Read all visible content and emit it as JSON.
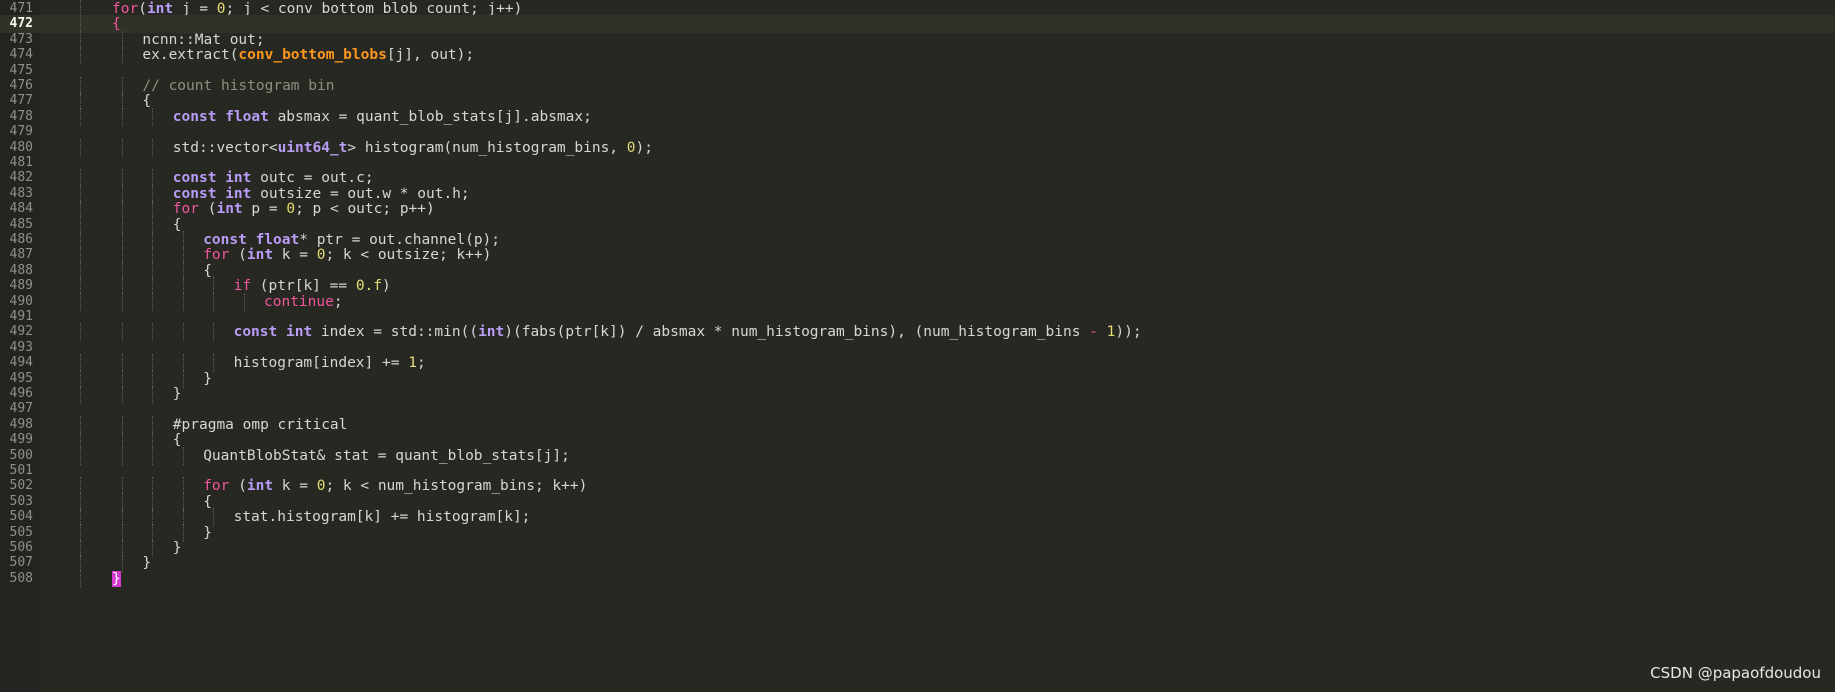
{
  "editor": {
    "watermark": "CSDN @papaofdoudou",
    "current_line": "472",
    "colors": {
      "background": "#272822",
      "keyword_control": "#f0579c",
      "keyword_type": "#b99cf5",
      "number": "#e6db74",
      "highlight_function": "#fd971f",
      "comment": "#8e8d80"
    },
    "lines": [
      {
        "num": "471",
        "indent": 1,
        "tokens": [
          [
            "kw-ctrl",
            "for"
          ],
          [
            "",
            "("
          ],
          [
            "kw-type",
            "int"
          ],
          [
            "",
            " j = "
          ],
          [
            "num",
            "0"
          ],
          [
            "",
            "; j < conv_bottom_blob_count; j++)"
          ]
        ]
      },
      {
        "num": "472",
        "indent": 1,
        "tokens": [
          [
            "kw-ctrl",
            "{"
          ]
        ]
      },
      {
        "num": "473",
        "indent": 2,
        "tokens": [
          [
            "",
            "ncnn::Mat out;"
          ]
        ]
      },
      {
        "num": "474",
        "indent": 2,
        "tokens": [
          [
            "",
            "ex.extract("
          ],
          [
            "fn-hl",
            "conv_bottom_blobs"
          ],
          [
            "",
            "[j], out);"
          ]
        ]
      },
      {
        "num": "475",
        "indent": 0,
        "tokens": []
      },
      {
        "num": "476",
        "indent": 2,
        "tokens": [
          [
            "cmt",
            "// count histogram bin"
          ]
        ]
      },
      {
        "num": "477",
        "indent": 2,
        "tokens": [
          [
            "",
            "{"
          ]
        ]
      },
      {
        "num": "478",
        "indent": 3,
        "tokens": [
          [
            "kw-type",
            "const"
          ],
          [
            "",
            " "
          ],
          [
            "kw-type",
            "float"
          ],
          [
            "",
            " absmax = quant_blob_stats[j].absmax;"
          ]
        ]
      },
      {
        "num": "479",
        "indent": 0,
        "tokens": []
      },
      {
        "num": "480",
        "indent": 3,
        "tokens": [
          [
            "",
            "std::vector<"
          ],
          [
            "kw-type",
            "uint64_t"
          ],
          [
            "",
            "> histogram(num_histogram_bins, "
          ],
          [
            "num",
            "0"
          ],
          [
            "",
            ");"
          ]
        ]
      },
      {
        "num": "481",
        "indent": 0,
        "tokens": []
      },
      {
        "num": "482",
        "indent": 3,
        "tokens": [
          [
            "kw-type",
            "const"
          ],
          [
            "",
            " "
          ],
          [
            "kw-type",
            "int"
          ],
          [
            "",
            " outc = out.c;"
          ]
        ]
      },
      {
        "num": "483",
        "indent": 3,
        "tokens": [
          [
            "kw-type",
            "const"
          ],
          [
            "",
            " "
          ],
          [
            "kw-type",
            "int"
          ],
          [
            "",
            " outsize = out.w * out.h;"
          ]
        ]
      },
      {
        "num": "484",
        "indent": 3,
        "tokens": [
          [
            "kw-ctrl",
            "for"
          ],
          [
            "",
            " ("
          ],
          [
            "kw-type",
            "int"
          ],
          [
            "",
            " p = "
          ],
          [
            "num",
            "0"
          ],
          [
            "",
            "; p < outc; p++)"
          ]
        ]
      },
      {
        "num": "485",
        "indent": 3,
        "tokens": [
          [
            "",
            "{"
          ]
        ]
      },
      {
        "num": "486",
        "indent": 4,
        "tokens": [
          [
            "kw-type",
            "const"
          ],
          [
            "",
            " "
          ],
          [
            "kw-type",
            "float"
          ],
          [
            "",
            "* ptr = out.channel(p);"
          ]
        ]
      },
      {
        "num": "487",
        "indent": 4,
        "tokens": [
          [
            "kw-ctrl",
            "for"
          ],
          [
            "",
            " ("
          ],
          [
            "kw-type",
            "int"
          ],
          [
            "",
            " k = "
          ],
          [
            "num",
            "0"
          ],
          [
            "",
            "; k < outsize; k++)"
          ]
        ]
      },
      {
        "num": "488",
        "indent": 4,
        "tokens": [
          [
            "",
            "{"
          ]
        ]
      },
      {
        "num": "489",
        "indent": 5,
        "tokens": [
          [
            "kw-ctrl",
            "if"
          ],
          [
            "",
            " (ptr[k] == "
          ],
          [
            "num",
            "0.f"
          ],
          [
            "",
            ")"
          ]
        ]
      },
      {
        "num": "490",
        "indent": 6,
        "tokens": [
          [
            "kw-ctrl",
            "continue"
          ],
          [
            "",
            ";"
          ]
        ]
      },
      {
        "num": "491",
        "indent": 0,
        "tokens": []
      },
      {
        "num": "492",
        "indent": 5,
        "tokens": [
          [
            "kw-type",
            "const"
          ],
          [
            "",
            " "
          ],
          [
            "kw-type",
            "int"
          ],
          [
            "",
            " index = std::min(("
          ],
          [
            "kw-type",
            "int"
          ],
          [
            "",
            ")(fabs(ptr[k]) / absmax * num_histogram_bins), (num_histogram_bins "
          ],
          [
            "op",
            "-"
          ],
          [
            "",
            " "
          ],
          [
            "num",
            "1"
          ],
          [
            "",
            "));"
          ]
        ]
      },
      {
        "num": "493",
        "indent": 0,
        "tokens": []
      },
      {
        "num": "494",
        "indent": 5,
        "tokens": [
          [
            "",
            "histogram[index] += "
          ],
          [
            "num",
            "1"
          ],
          [
            "",
            ";"
          ]
        ]
      },
      {
        "num": "495",
        "indent": 4,
        "tokens": [
          [
            "",
            "}"
          ]
        ]
      },
      {
        "num": "496",
        "indent": 3,
        "tokens": [
          [
            "",
            "}"
          ]
        ]
      },
      {
        "num": "497",
        "indent": 0,
        "tokens": []
      },
      {
        "num": "498",
        "indent": 3,
        "tokens": [
          [
            "",
            "#pragma omp critical"
          ]
        ]
      },
      {
        "num": "499",
        "indent": 3,
        "tokens": [
          [
            "",
            "{"
          ]
        ]
      },
      {
        "num": "500",
        "indent": 4,
        "tokens": [
          [
            "",
            "QuantBlobStat& stat = quant_blob_stats[j];"
          ]
        ]
      },
      {
        "num": "501",
        "indent": 0,
        "tokens": []
      },
      {
        "num": "502",
        "indent": 4,
        "tokens": [
          [
            "kw-ctrl",
            "for"
          ],
          [
            "",
            " ("
          ],
          [
            "kw-type",
            "int"
          ],
          [
            "",
            " k = "
          ],
          [
            "num",
            "0"
          ],
          [
            "",
            "; k < num_histogram_bins; k++)"
          ]
        ]
      },
      {
        "num": "503",
        "indent": 4,
        "tokens": [
          [
            "",
            "{"
          ]
        ]
      },
      {
        "num": "504",
        "indent": 5,
        "tokens": [
          [
            "",
            "stat.histogram[k] += histogram[k];"
          ]
        ]
      },
      {
        "num": "505",
        "indent": 4,
        "tokens": [
          [
            "",
            "}"
          ]
        ]
      },
      {
        "num": "506",
        "indent": 3,
        "tokens": [
          [
            "",
            "}"
          ]
        ]
      },
      {
        "num": "507",
        "indent": 2,
        "tokens": [
          [
            "",
            "}"
          ]
        ]
      },
      {
        "num": "508",
        "indent": 1,
        "tokens": [
          [
            "brace-hl",
            "}"
          ]
        ]
      }
    ]
  }
}
